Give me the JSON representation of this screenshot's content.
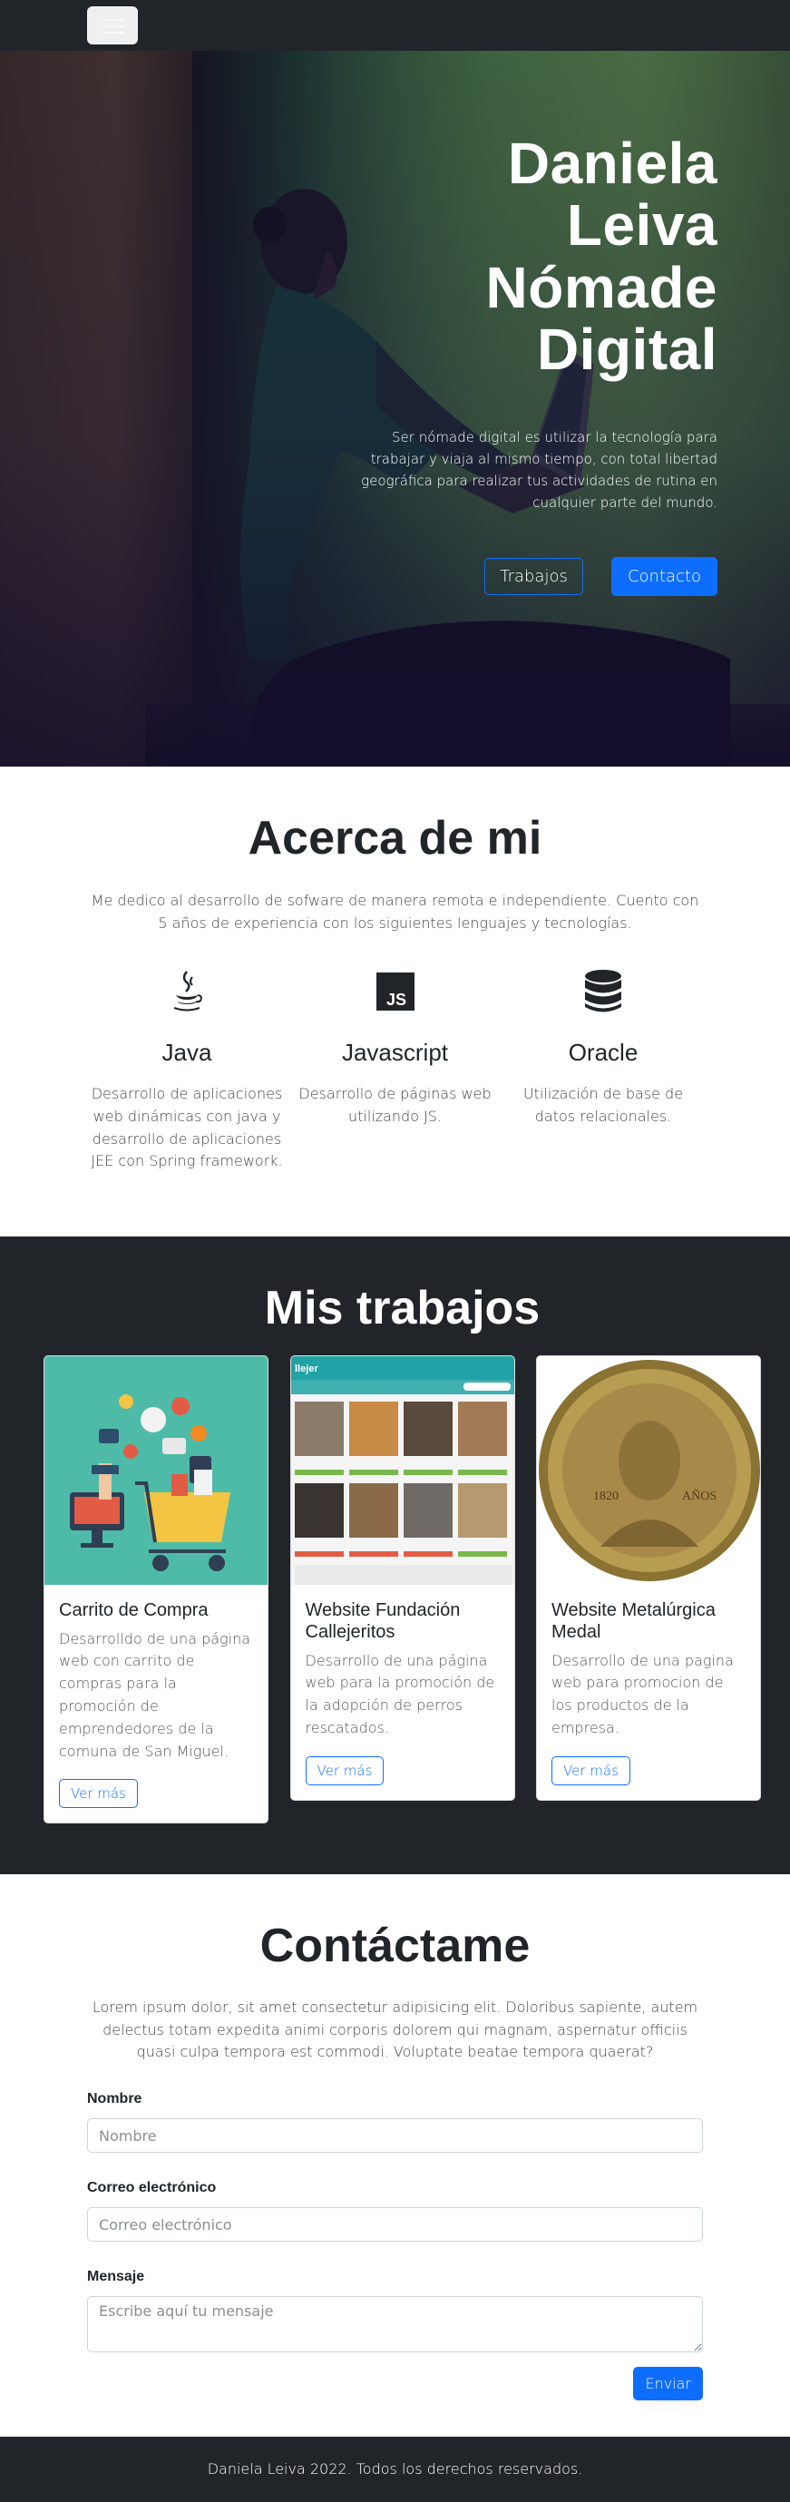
{
  "navbar": {
    "toggler_icon": "hamburger-icon"
  },
  "hero": {
    "title_lines": [
      "Daniela",
      "Leiva",
      "Nómade",
      "Digital"
    ],
    "text": "Ser nómade digital es utilizar la tecnología para trabajar y viaja al mismo tiempo, con total libertad geográfica para realizar tus actividades de rutina en cualquier parte del mundo.",
    "btn_trabajos": "Trabajos",
    "btn_contacto": "Contacto"
  },
  "about": {
    "title": "Acerca de mi",
    "lead": "Me dedico al desarrollo de sofware de manera remota e independiente. Cuento con 5 años de experiencia con los siguientes lenguajes y tecnologías.",
    "skills": [
      {
        "icon": "java-icon",
        "name": "Java",
        "desc": "Desarrollo de aplicaciones web dinámicas con java y desarrollo de aplicaciones JEE con Spring framework."
      },
      {
        "icon": "javascript-icon",
        "name": "Javascript",
        "desc": "Desarrollo de páginas web utilizando JS."
      },
      {
        "icon": "database-icon",
        "name": "Oracle",
        "desc": "Utilización de base de datos relacionales."
      }
    ]
  },
  "works": {
    "title": "Mis trabajos",
    "cards": [
      {
        "title": "Carrito de Compra",
        "text": "Desarrolldo de una página web con carrito de compras para la promoción de emprendedores de la comuna de San Miguel.",
        "button": "Ver más"
      },
      {
        "title": "Website Fundación Callejeritos",
        "text": "Desarrollo de una página web para la promoción de la adopción de perros rescatados.",
        "button": "Ver más"
      },
      {
        "title": "Website Metalúrgica Medal",
        "text": "Desarrollo de una pagina web para promocion de los productos de la empresa.",
        "button": "Ver más"
      }
    ],
    "mock_site_brand": "llejer",
    "medal_text": {
      "left": "1820",
      "right": "AÑOS"
    }
  },
  "contact": {
    "title": "Contáctame",
    "lead": "Lorem ipsum dolor, sit amet consectetur adipisicing elit. Doloribus sapiente, autem delectus totam expedita animi corporis dolorem qui magnam, aspernatur officiis quasi culpa tempora est commodi. Voluptate beatae tempora quaerat?",
    "name_label": "Nombre",
    "name_placeholder": "Nombre",
    "email_label": "Correo electrónico",
    "email_placeholder": "Correo electrónico",
    "message_label": "Mensaje",
    "message_placeholder": "Escribe aquí tu mensaje",
    "submit": "Enviar"
  },
  "footer": {
    "text": "Daniela Leiva 2022. Todos los derechos reservados."
  },
  "colors": {
    "dark": "#212529",
    "primary": "#0d6efd",
    "teal": "#4ebba8"
  }
}
